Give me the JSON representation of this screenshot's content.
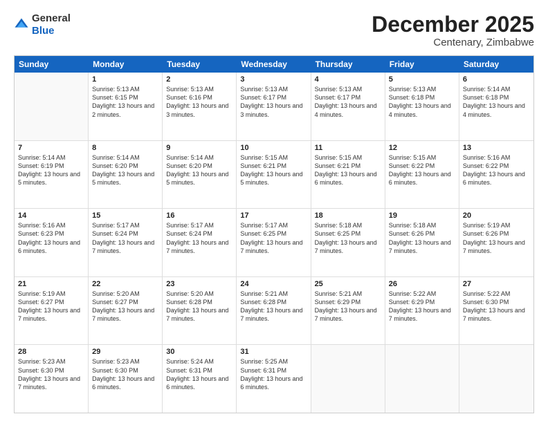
{
  "logo": {
    "general": "General",
    "blue": "Blue"
  },
  "title": "December 2025",
  "subtitle": "Centenary, Zimbabwe",
  "header_days": [
    "Sunday",
    "Monday",
    "Tuesday",
    "Wednesday",
    "Thursday",
    "Friday",
    "Saturday"
  ],
  "weeks": [
    [
      {
        "day": "",
        "sunrise": "",
        "sunset": "",
        "daylight": ""
      },
      {
        "day": "1",
        "sunrise": "Sunrise: 5:13 AM",
        "sunset": "Sunset: 6:15 PM",
        "daylight": "Daylight: 13 hours and 2 minutes."
      },
      {
        "day": "2",
        "sunrise": "Sunrise: 5:13 AM",
        "sunset": "Sunset: 6:16 PM",
        "daylight": "Daylight: 13 hours and 3 minutes."
      },
      {
        "day": "3",
        "sunrise": "Sunrise: 5:13 AM",
        "sunset": "Sunset: 6:17 PM",
        "daylight": "Daylight: 13 hours and 3 minutes."
      },
      {
        "day": "4",
        "sunrise": "Sunrise: 5:13 AM",
        "sunset": "Sunset: 6:17 PM",
        "daylight": "Daylight: 13 hours and 4 minutes."
      },
      {
        "day": "5",
        "sunrise": "Sunrise: 5:13 AM",
        "sunset": "Sunset: 6:18 PM",
        "daylight": "Daylight: 13 hours and 4 minutes."
      },
      {
        "day": "6",
        "sunrise": "Sunrise: 5:14 AM",
        "sunset": "Sunset: 6:18 PM",
        "daylight": "Daylight: 13 hours and 4 minutes."
      }
    ],
    [
      {
        "day": "7",
        "sunrise": "Sunrise: 5:14 AM",
        "sunset": "Sunset: 6:19 PM",
        "daylight": "Daylight: 13 hours and 5 minutes."
      },
      {
        "day": "8",
        "sunrise": "Sunrise: 5:14 AM",
        "sunset": "Sunset: 6:20 PM",
        "daylight": "Daylight: 13 hours and 5 minutes."
      },
      {
        "day": "9",
        "sunrise": "Sunrise: 5:14 AM",
        "sunset": "Sunset: 6:20 PM",
        "daylight": "Daylight: 13 hours and 5 minutes."
      },
      {
        "day": "10",
        "sunrise": "Sunrise: 5:15 AM",
        "sunset": "Sunset: 6:21 PM",
        "daylight": "Daylight: 13 hours and 5 minutes."
      },
      {
        "day": "11",
        "sunrise": "Sunrise: 5:15 AM",
        "sunset": "Sunset: 6:21 PM",
        "daylight": "Daylight: 13 hours and 6 minutes."
      },
      {
        "day": "12",
        "sunrise": "Sunrise: 5:15 AM",
        "sunset": "Sunset: 6:22 PM",
        "daylight": "Daylight: 13 hours and 6 minutes."
      },
      {
        "day": "13",
        "sunrise": "Sunrise: 5:16 AM",
        "sunset": "Sunset: 6:22 PM",
        "daylight": "Daylight: 13 hours and 6 minutes."
      }
    ],
    [
      {
        "day": "14",
        "sunrise": "Sunrise: 5:16 AM",
        "sunset": "Sunset: 6:23 PM",
        "daylight": "Daylight: 13 hours and 6 minutes."
      },
      {
        "day": "15",
        "sunrise": "Sunrise: 5:17 AM",
        "sunset": "Sunset: 6:24 PM",
        "daylight": "Daylight: 13 hours and 7 minutes."
      },
      {
        "day": "16",
        "sunrise": "Sunrise: 5:17 AM",
        "sunset": "Sunset: 6:24 PM",
        "daylight": "Daylight: 13 hours and 7 minutes."
      },
      {
        "day": "17",
        "sunrise": "Sunrise: 5:17 AM",
        "sunset": "Sunset: 6:25 PM",
        "daylight": "Daylight: 13 hours and 7 minutes."
      },
      {
        "day": "18",
        "sunrise": "Sunrise: 5:18 AM",
        "sunset": "Sunset: 6:25 PM",
        "daylight": "Daylight: 13 hours and 7 minutes."
      },
      {
        "day": "19",
        "sunrise": "Sunrise: 5:18 AM",
        "sunset": "Sunset: 6:26 PM",
        "daylight": "Daylight: 13 hours and 7 minutes."
      },
      {
        "day": "20",
        "sunrise": "Sunrise: 5:19 AM",
        "sunset": "Sunset: 6:26 PM",
        "daylight": "Daylight: 13 hours and 7 minutes."
      }
    ],
    [
      {
        "day": "21",
        "sunrise": "Sunrise: 5:19 AM",
        "sunset": "Sunset: 6:27 PM",
        "daylight": "Daylight: 13 hours and 7 minutes."
      },
      {
        "day": "22",
        "sunrise": "Sunrise: 5:20 AM",
        "sunset": "Sunset: 6:27 PM",
        "daylight": "Daylight: 13 hours and 7 minutes."
      },
      {
        "day": "23",
        "sunrise": "Sunrise: 5:20 AM",
        "sunset": "Sunset: 6:28 PM",
        "daylight": "Daylight: 13 hours and 7 minutes."
      },
      {
        "day": "24",
        "sunrise": "Sunrise: 5:21 AM",
        "sunset": "Sunset: 6:28 PM",
        "daylight": "Daylight: 13 hours and 7 minutes."
      },
      {
        "day": "25",
        "sunrise": "Sunrise: 5:21 AM",
        "sunset": "Sunset: 6:29 PM",
        "daylight": "Daylight: 13 hours and 7 minutes."
      },
      {
        "day": "26",
        "sunrise": "Sunrise: 5:22 AM",
        "sunset": "Sunset: 6:29 PM",
        "daylight": "Daylight: 13 hours and 7 minutes."
      },
      {
        "day": "27",
        "sunrise": "Sunrise: 5:22 AM",
        "sunset": "Sunset: 6:30 PM",
        "daylight": "Daylight: 13 hours and 7 minutes."
      }
    ],
    [
      {
        "day": "28",
        "sunrise": "Sunrise: 5:23 AM",
        "sunset": "Sunset: 6:30 PM",
        "daylight": "Daylight: 13 hours and 7 minutes."
      },
      {
        "day": "29",
        "sunrise": "Sunrise: 5:23 AM",
        "sunset": "Sunset: 6:30 PM",
        "daylight": "Daylight: 13 hours and 6 minutes."
      },
      {
        "day": "30",
        "sunrise": "Sunrise: 5:24 AM",
        "sunset": "Sunset: 6:31 PM",
        "daylight": "Daylight: 13 hours and 6 minutes."
      },
      {
        "day": "31",
        "sunrise": "Sunrise: 5:25 AM",
        "sunset": "Sunset: 6:31 PM",
        "daylight": "Daylight: 13 hours and 6 minutes."
      },
      {
        "day": "",
        "sunrise": "",
        "sunset": "",
        "daylight": ""
      },
      {
        "day": "",
        "sunrise": "",
        "sunset": "",
        "daylight": ""
      },
      {
        "day": "",
        "sunrise": "",
        "sunset": "",
        "daylight": ""
      }
    ]
  ]
}
